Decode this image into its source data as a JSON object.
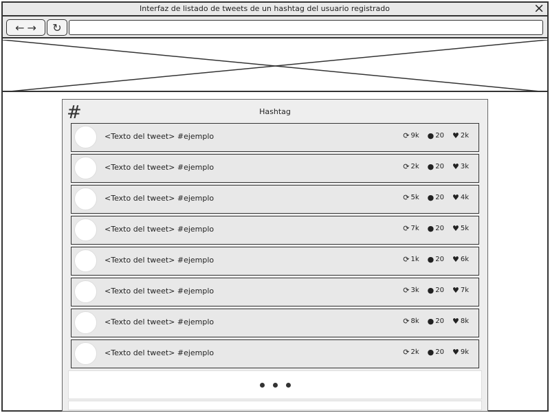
{
  "window": {
    "title": "Interfaz de listado de tweets de un hashtag del usuario registrado"
  },
  "icons": {
    "close": "×",
    "back": "←",
    "forward": "→",
    "refresh": "↻",
    "hash": "#",
    "retweet": "⟳",
    "reply": "●",
    "like": "♥"
  },
  "browser": {
    "address_value": ""
  },
  "panel": {
    "title": "Hashtag"
  },
  "tweets": [
    {
      "text": "<Texto del tweet> #ejemplo",
      "retweets": "9k",
      "replies": "20",
      "likes": "2k"
    },
    {
      "text": "<Texto del tweet> #ejemplo",
      "retweets": "2k",
      "replies": "20",
      "likes": "3k"
    },
    {
      "text": "<Texto del tweet> #ejemplo",
      "retweets": "5k",
      "replies": "20",
      "likes": "4k"
    },
    {
      "text": "<Texto del tweet> #ejemplo",
      "retweets": "7k",
      "replies": "20",
      "likes": "5k"
    },
    {
      "text": "<Texto del tweet> #ejemplo",
      "retweets": "1k",
      "replies": "20",
      "likes": "6k"
    },
    {
      "text": "<Texto del tweet> #ejemplo",
      "retweets": "3k",
      "replies": "20",
      "likes": "7k"
    },
    {
      "text": "<Texto del tweet> #ejemplo",
      "retweets": "8k",
      "replies": "20",
      "likes": "8k"
    },
    {
      "text": "<Texto del tweet> #ejemplo",
      "retweets": "2k",
      "replies": "20",
      "likes": "9k"
    }
  ]
}
